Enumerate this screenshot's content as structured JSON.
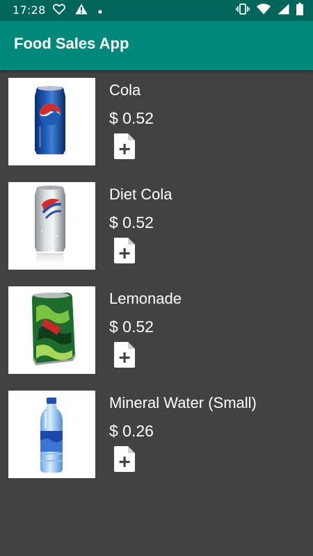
{
  "status_bar": {
    "time": "17:28",
    "left_icons": [
      "heart-outline-icon",
      "warning-icon",
      "dot-icon"
    ],
    "right_icons": [
      "vibrate-icon",
      "wifi-icon",
      "signal-icon",
      "battery-icon"
    ]
  },
  "app_bar": {
    "title": "Food Sales App",
    "color": "#00897b"
  },
  "products": [
    {
      "name": "Cola",
      "price": "$ 0.52",
      "image": "cola-can"
    },
    {
      "name": "Diet Cola",
      "price": "$ 0.52",
      "image": "diet-cola-can"
    },
    {
      "name": "Lemonade",
      "price": "$ 0.52",
      "image": "lemonade-can"
    },
    {
      "name": "Mineral Water (Small)",
      "price": "$ 0.26",
      "image": "water-bottle"
    }
  ],
  "colors": {
    "status_bar": "#00665c",
    "app_bar": "#00897b",
    "background": "#424242",
    "text": "#ffffff"
  }
}
